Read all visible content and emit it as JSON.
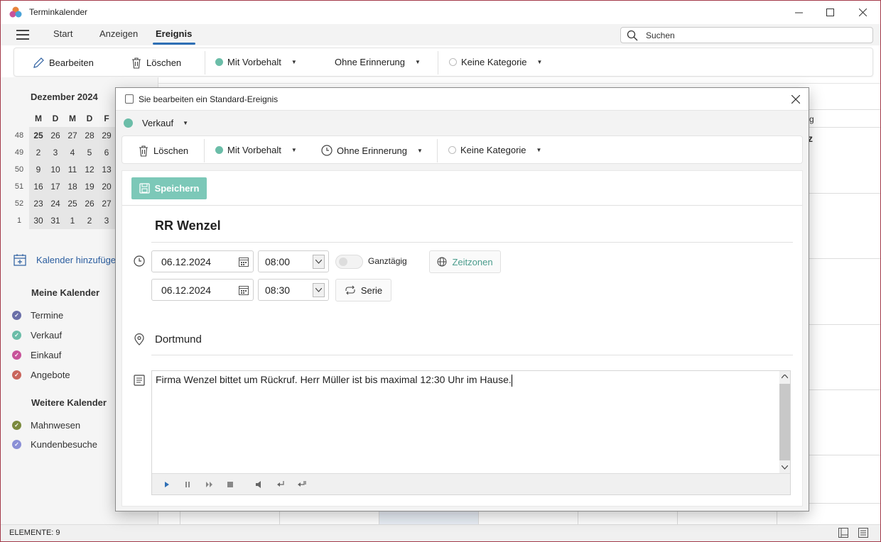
{
  "window": {
    "title": "Terminkalender"
  },
  "ribbon": {
    "tabs": [
      {
        "label": "Start"
      },
      {
        "label": "Anzeigen"
      },
      {
        "label": "Ereignis"
      }
    ],
    "search_label": "Suchen"
  },
  "toolbar": {
    "edit": "Bearbeiten",
    "delete": "Löschen",
    "status": "Mit Vorbehalt",
    "reminder": "Ohne Erinnerung",
    "category": "Keine Kategorie"
  },
  "mini_calendar": {
    "month": "Dezember 2024",
    "weekday_headers": [
      "M",
      "D",
      "M",
      "D",
      "F"
    ],
    "weeks": [
      {
        "week": "48",
        "days": [
          "25",
          "26",
          "27",
          "28",
          "29"
        ]
      },
      {
        "week": "49",
        "days": [
          "2",
          "3",
          "4",
          "5",
          "6"
        ]
      },
      {
        "week": "50",
        "days": [
          "9",
          "10",
          "11",
          "12",
          "13"
        ]
      },
      {
        "week": "51",
        "days": [
          "16",
          "17",
          "18",
          "19",
          "20"
        ]
      },
      {
        "week": "52",
        "days": [
          "23",
          "24",
          "25",
          "26",
          "27"
        ]
      },
      {
        "week": "1",
        "days": [
          "30",
          "31",
          "1",
          "2",
          "3"
        ]
      }
    ]
  },
  "sidebar": {
    "add_calendar": "Kalender hinzufüge",
    "my_calendars_title": "Meine Kalender",
    "my_calendars": [
      {
        "label": "Termine",
        "color": "#6a6fa8"
      },
      {
        "label": "Verkauf",
        "color": "#6bbda8"
      },
      {
        "label": "Einkauf",
        "color": "#c8539a"
      },
      {
        "label": "Angebote",
        "color": "#c9655c"
      }
    ],
    "more_calendars_title": "Weitere Kalender",
    "more_calendars": [
      {
        "label": "Mahnwesen",
        "color": "#7b8a3e"
      },
      {
        "label": "Kundenbesuche",
        "color": "#8a8fd6"
      }
    ]
  },
  "background": {
    "partial_header": "g",
    "partial_letter": "z"
  },
  "status_bar": {
    "text": "ELEMENTE: 9"
  },
  "dialog": {
    "title": "Sie bearbeiten ein Standard-Ereignis",
    "calendar": "Verkauf",
    "toolbar": {
      "delete": "Löschen",
      "status": "Mit Vorbehalt",
      "reminder": "Ohne Erinnerung",
      "category": "Keine Kategorie"
    },
    "save_label": "Speichern",
    "subject": "RR Wenzel",
    "start_date": "06.12.2024",
    "start_time": "08:00",
    "end_date": "06.12.2024",
    "end_time": "08:30",
    "all_day_label": "Ganztägig",
    "timezones_label": "Zeitzonen",
    "series_label": "Serie",
    "location": "Dortmund",
    "notes": "Firma Wenzel bittet um Rückruf. Herr Müller ist bis maximal 12:30 Uhr im Hause."
  }
}
